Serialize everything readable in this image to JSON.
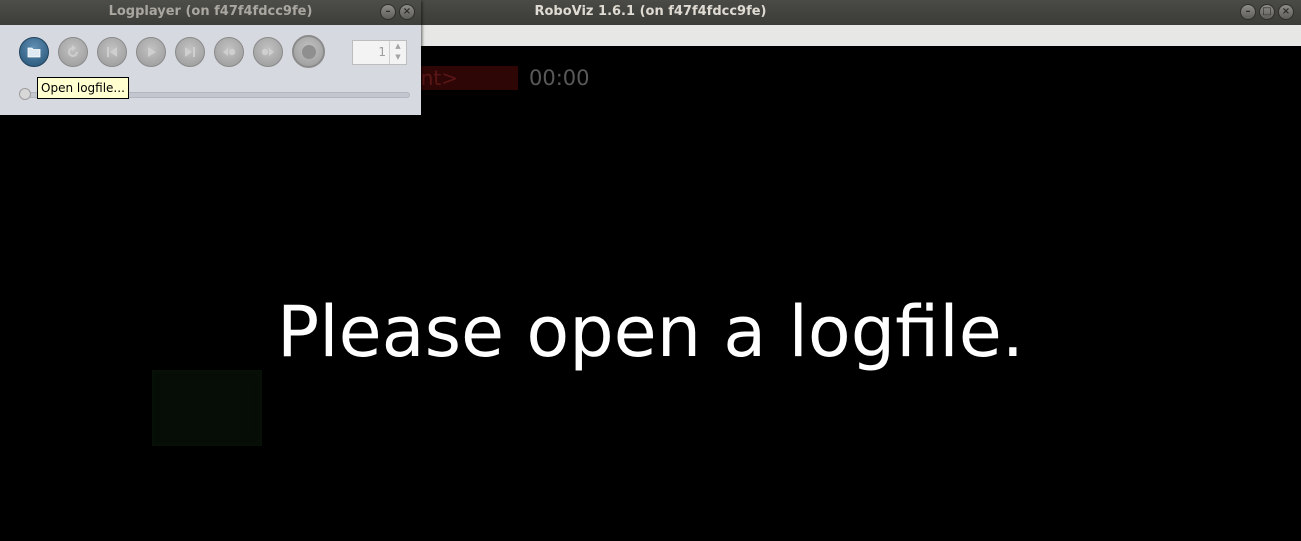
{
  "main_window": {
    "title": "RoboViz 1.6.1 (on f47f4fdcc9fe)",
    "viewport": {
      "team_badge_text": "nt>",
      "game_time": "00:00",
      "message": "Please open a logfile."
    }
  },
  "logplayer": {
    "title": "Logplayer (on f47f4fdcc9fe)",
    "frame_step": "1",
    "tooltip": "Open logfile...",
    "seek_position": 0,
    "buttons": [
      {
        "name": "open-logfile",
        "icon": "folder-icon"
      },
      {
        "name": "rewind",
        "icon": "rewind-icon"
      },
      {
        "name": "previous-frame",
        "icon": "skip-back-icon"
      },
      {
        "name": "play",
        "icon": "play-icon"
      },
      {
        "name": "next-frame",
        "icon": "skip-forward-icon"
      },
      {
        "name": "step-back",
        "icon": "step-back-icon"
      },
      {
        "name": "step-forward",
        "icon": "step-forward-icon"
      },
      {
        "name": "record",
        "icon": "record-icon"
      }
    ]
  },
  "colors": {
    "background": "#000000",
    "message_text": "#ffffff",
    "team_badge": "#2e0606",
    "tooltip_bg": "#ffffd0"
  }
}
